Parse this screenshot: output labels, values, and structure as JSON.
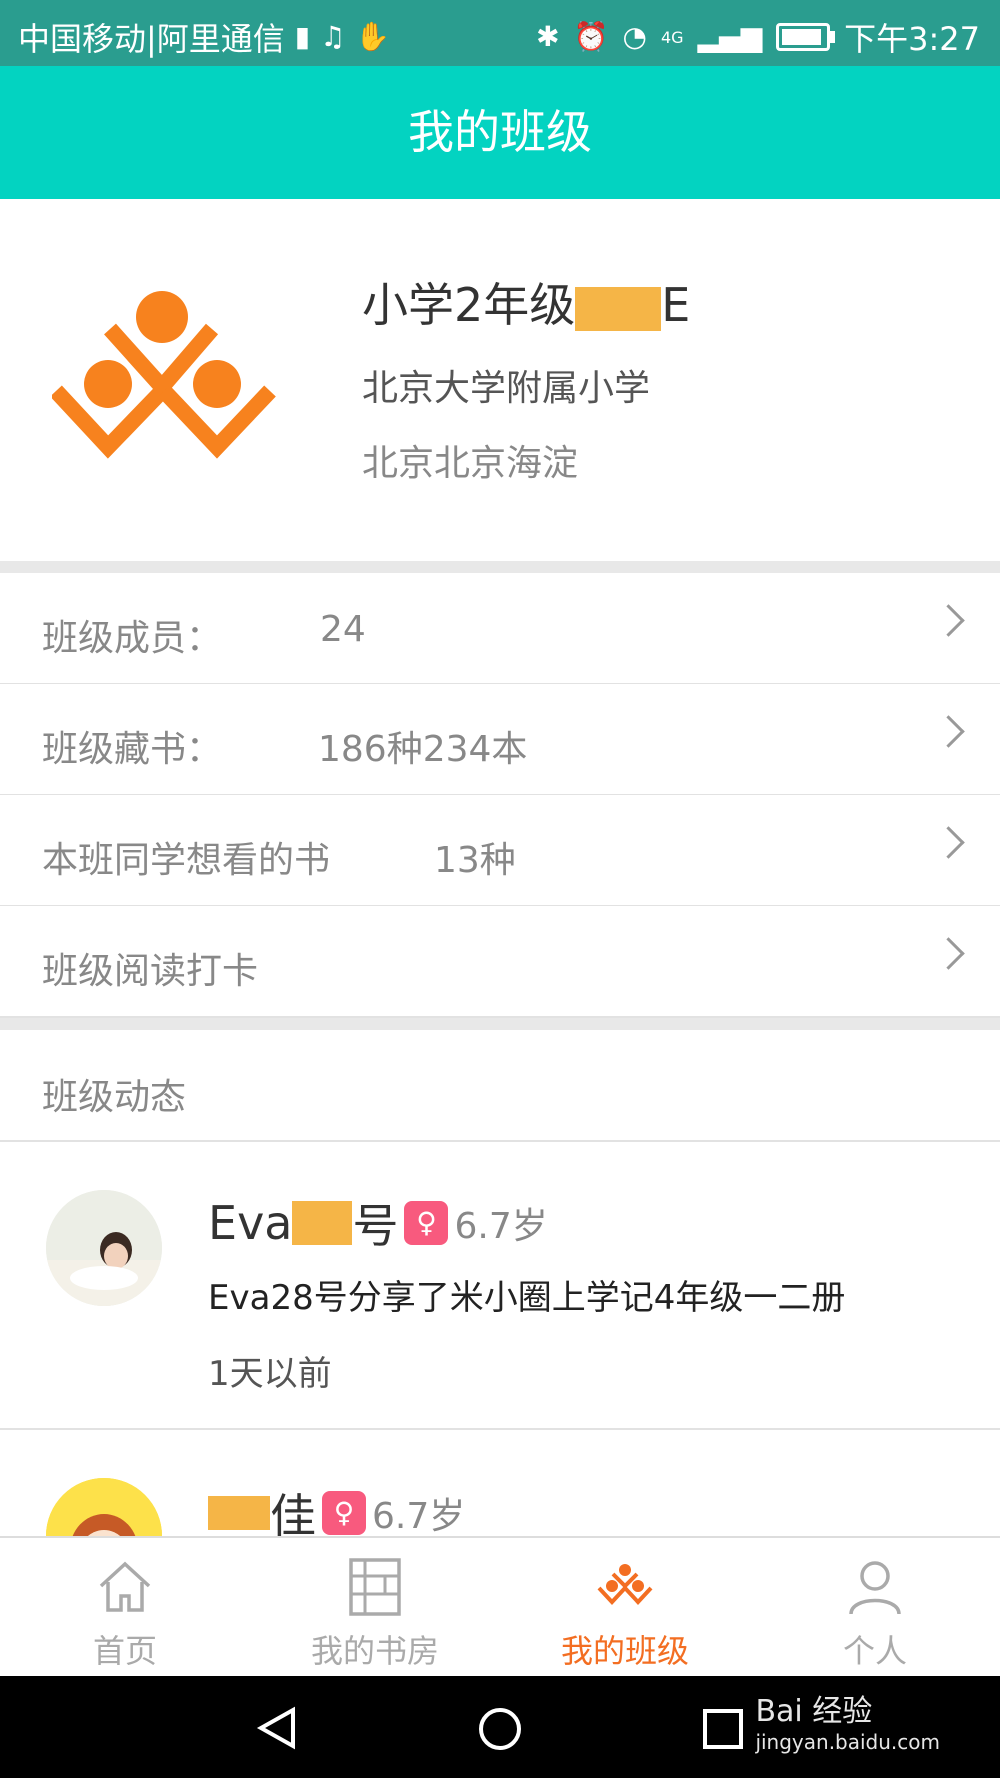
{
  "status_bar": {
    "carrier": "中国移动|阿里通信",
    "time": "下午3:27",
    "network": "4G"
  },
  "header": {
    "title": "我的班级"
  },
  "class_info": {
    "name_prefix": "小学2年级",
    "name_suffix": "E",
    "school": "北京大学附属小学",
    "region": "北京北京海淀"
  },
  "rows": [
    {
      "label": "班级成员：",
      "value": "24"
    },
    {
      "label": "班级藏书：",
      "value": "186种234本"
    },
    {
      "label": "本班同学想看的书",
      "value": "13种"
    },
    {
      "label": "班级阅读打卡",
      "value": ""
    }
  ],
  "feed": {
    "section_title": "班级动态",
    "items": [
      {
        "name_prefix": "Eva",
        "name_suffix": "号",
        "age": "6.7岁",
        "text": "Eva28号分享了米小圈上学记4年级一二册",
        "time": "1天以前"
      },
      {
        "name_prefix": "",
        "name_suffix": "佳",
        "age": "6.7岁",
        "text": "",
        "time": ""
      }
    ]
  },
  "tabbar": {
    "tabs": [
      {
        "label": "首页",
        "icon": "home-icon"
      },
      {
        "label": "我的书房",
        "icon": "bookshelf-icon"
      },
      {
        "label": "我的班级",
        "icon": "class-icon"
      },
      {
        "label": "个人",
        "icon": "person-icon"
      }
    ],
    "active_index": 2
  },
  "watermark": {
    "brand": "Bai 经验",
    "url": "jingyan.baidu.com"
  },
  "colors": {
    "header": "#03d3c1",
    "accent": "#f36e22",
    "badge": "#f85a7e",
    "statusbar": "#2a9d8f"
  }
}
